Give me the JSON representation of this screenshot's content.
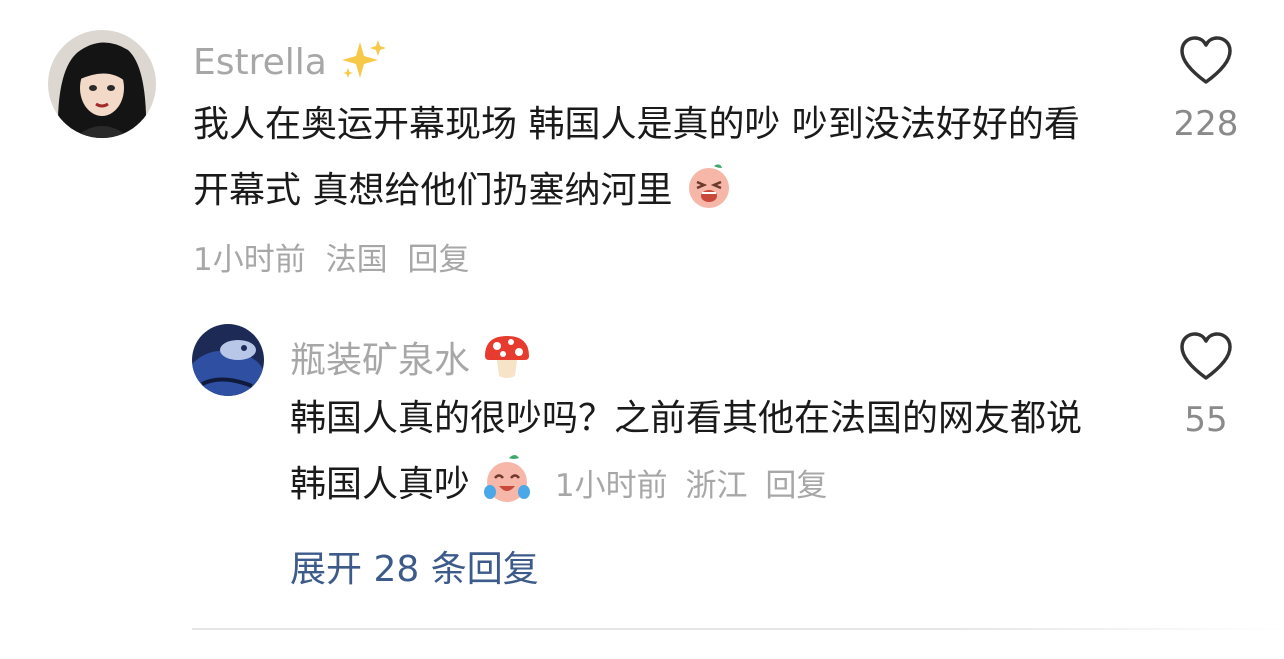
{
  "comment": {
    "username": "Estrella",
    "username_emoji": "sparkles-icon",
    "text": "我人在奥运开幕现场 韩国人是真的吵 吵到没法好好的看开幕式 真想给他们扔塞纳河里",
    "text_emoji": "crying-peach-icon",
    "time": "1小时前",
    "location": "法国",
    "reply_label": "回复",
    "like_count": "228"
  },
  "reply": {
    "username": "瓶装矿泉水",
    "username_emoji": "mushroom-icon",
    "text": "韩国人真的很吵吗？之前看其他在法国的网友都说韩国人真吵",
    "text_emoji": "laughing-crying-peach-icon",
    "time": "1小时前",
    "location": "浙江",
    "reply_label": "回复",
    "like_count": "55"
  },
  "expand_label": "展开 28 条回复",
  "colors": {
    "username": "#a7a7a7",
    "text": "#1a1a1a",
    "meta": "#a7a7a7",
    "expand": "#3c5a8a"
  }
}
